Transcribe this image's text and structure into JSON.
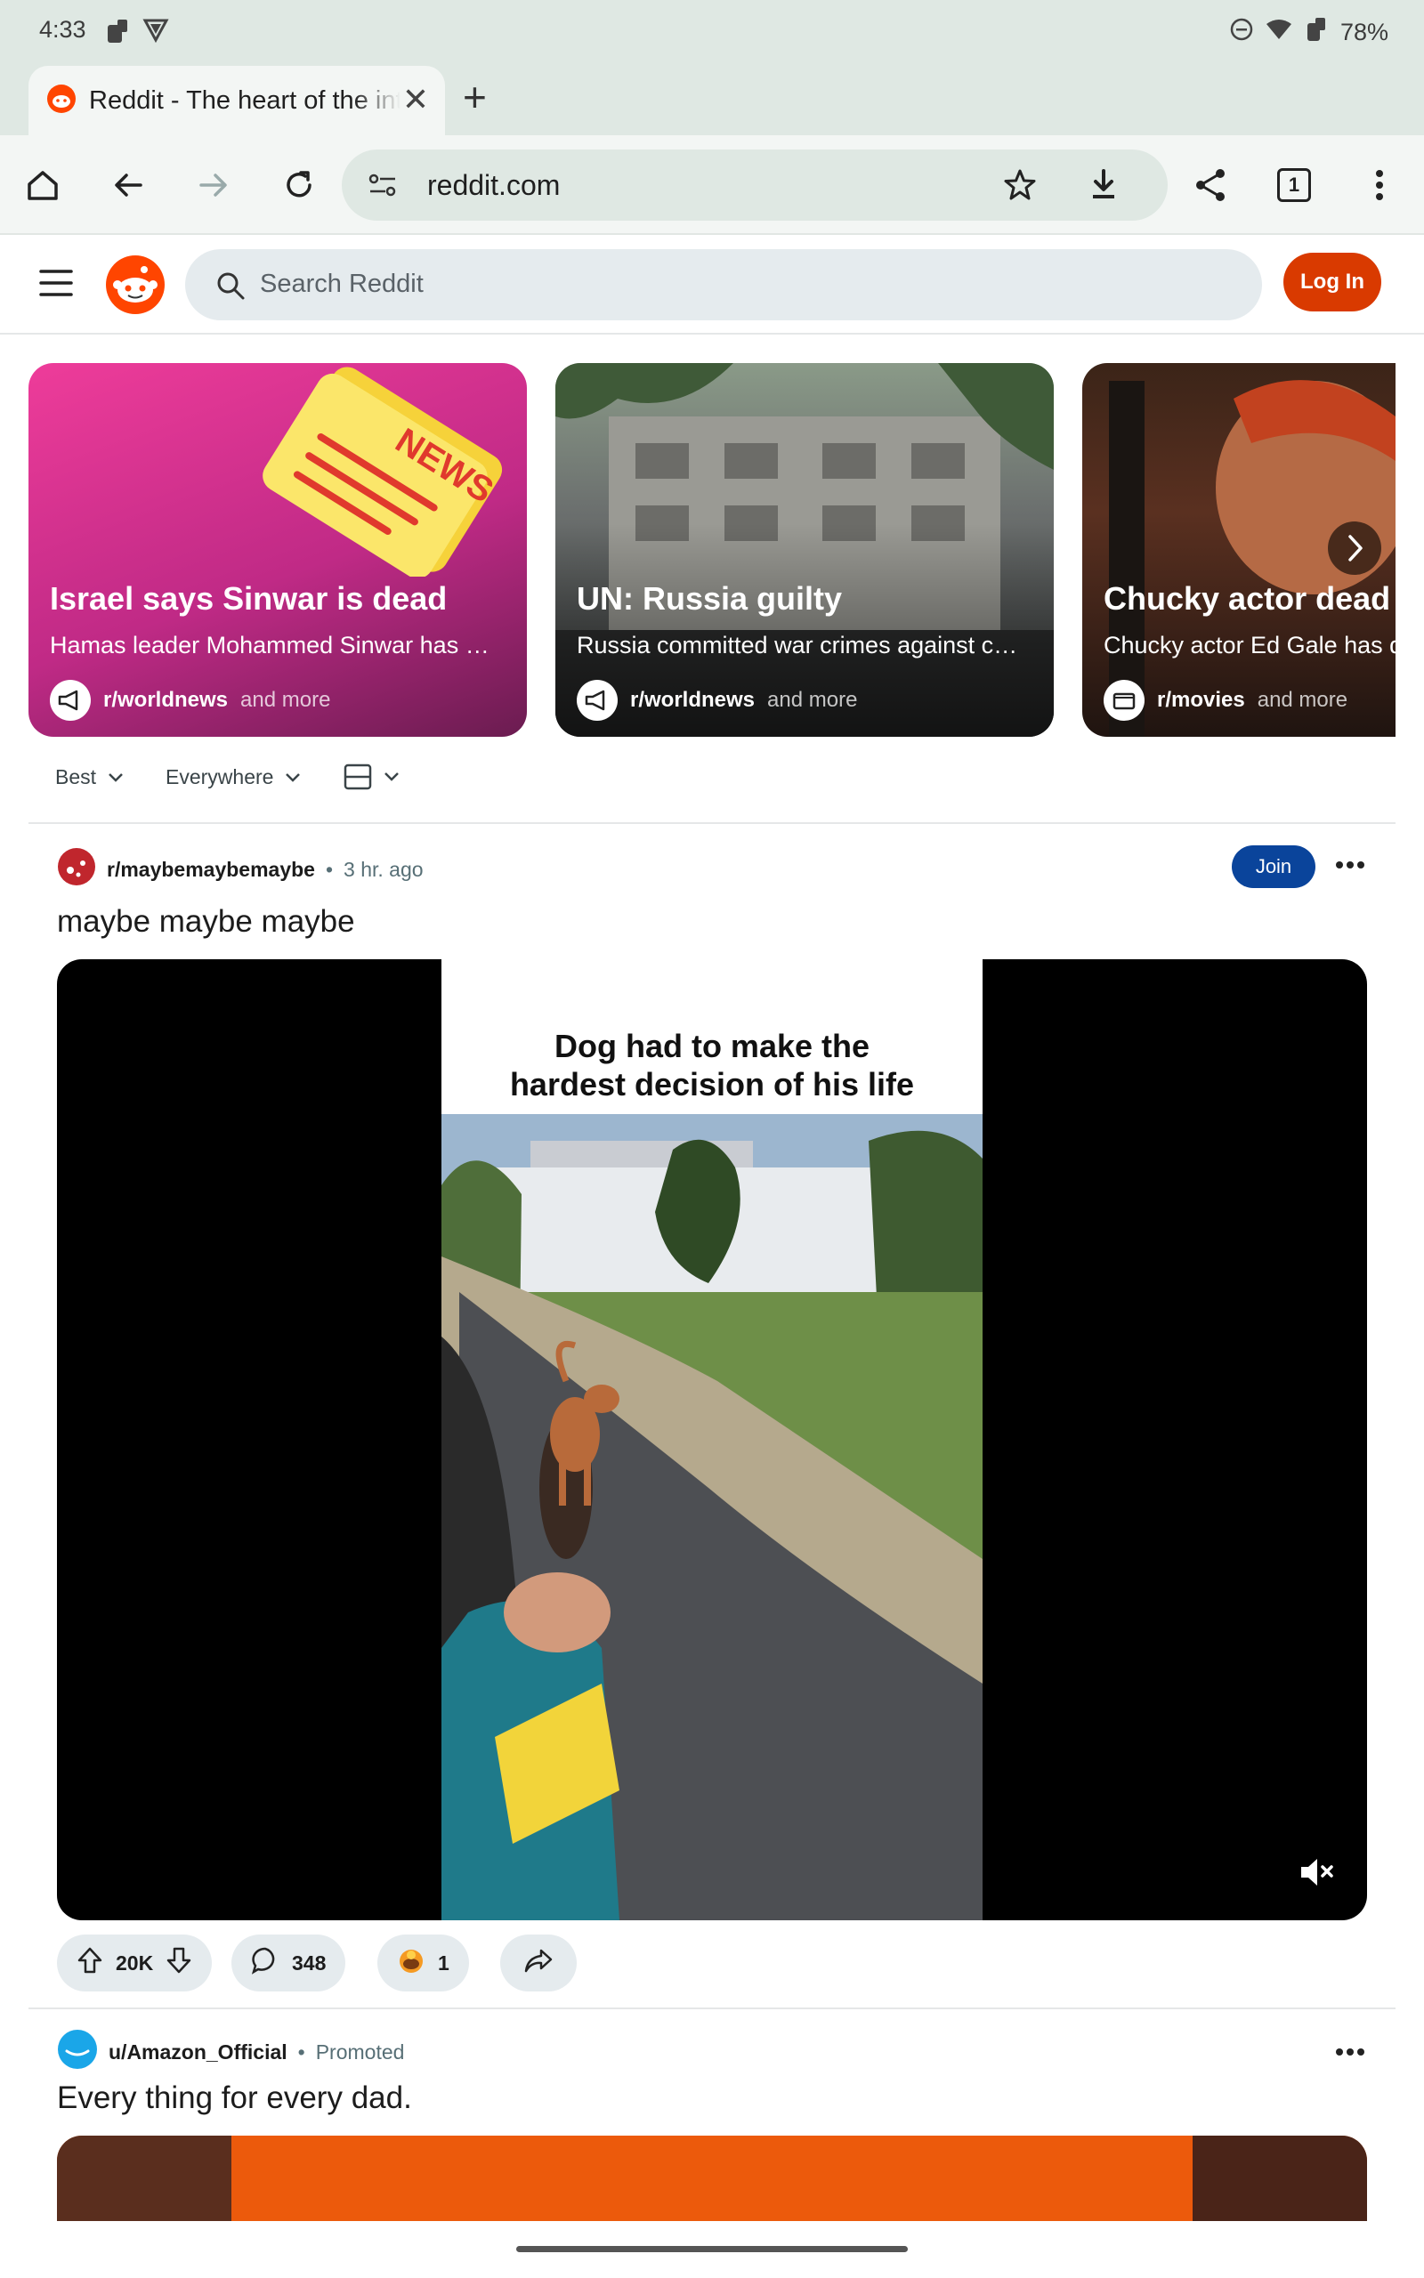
{
  "status_bar": {
    "time": "4:33",
    "battery": "78%"
  },
  "browser": {
    "tab_title": "Reddit - The heart of the internet",
    "url": "reddit.com",
    "tab_count": "1"
  },
  "reddit_header": {
    "search_placeholder": "Search Reddit",
    "login_label": "Log In"
  },
  "news_cards": [
    {
      "headline": "Israel says Sinwar is dead",
      "subtitle": "Hamas leader Mohammed Sinwar has …",
      "subreddit": "r/worldnews",
      "more": "and more",
      "image_text": "NEWS"
    },
    {
      "headline": "UN: Russia guilty",
      "subtitle": "Russia committed war crimes against c…",
      "subreddit": "r/worldnews",
      "more": "and more"
    },
    {
      "headline": "Chucky actor dead a",
      "subtitle": "Chucky actor Ed Gale has d",
      "subreddit": "r/movies",
      "more": "and more"
    }
  ],
  "filters": {
    "sort": "Best",
    "location": "Everywhere"
  },
  "post1": {
    "subreddit": "r/maybemaybemaybe",
    "time": "3 hr. ago",
    "join_label": "Join",
    "title": "maybe maybe maybe",
    "video_caption_line1": "Dog had to make the",
    "video_caption_line2": "hardest decision of his life",
    "votes": "20K",
    "comments": "348",
    "awards": "1"
  },
  "post2": {
    "user": "u/Amazon_Official",
    "label": "Promoted",
    "title": "Every thing for every dad."
  },
  "colors": {
    "reddit_orange": "#d93a00",
    "join_blue": "#0a449b",
    "chrome_bg": "#dfe8e3"
  }
}
